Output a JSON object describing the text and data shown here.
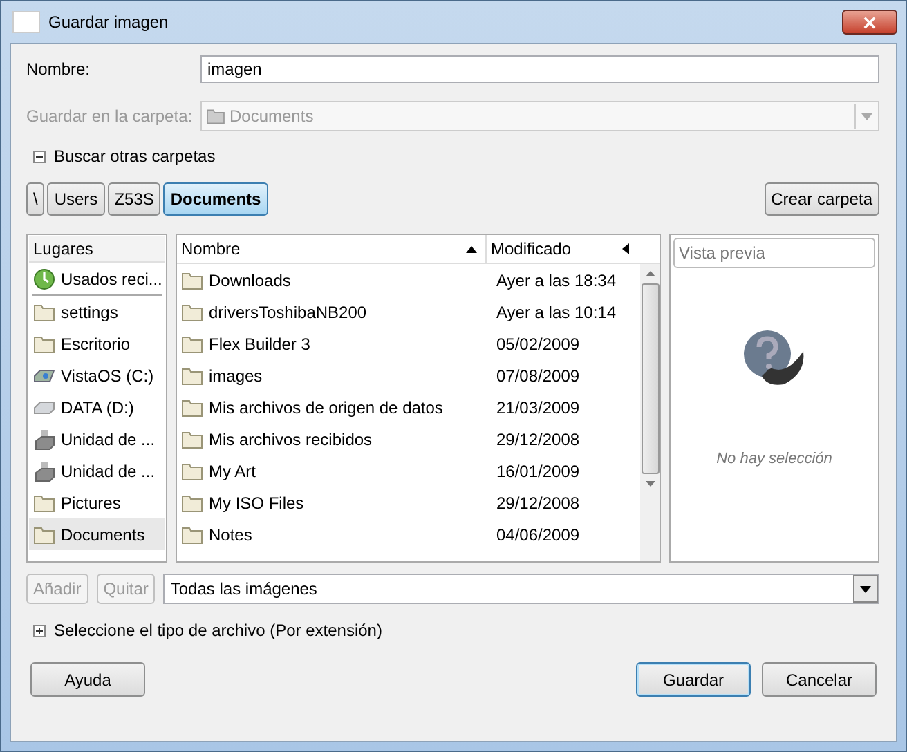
{
  "window": {
    "title": "Guardar imagen"
  },
  "name_field": {
    "label": "Nombre:",
    "value": "imagen"
  },
  "folder_field": {
    "label": "Guardar en la carpeta:",
    "value": "Documents",
    "disabled": true
  },
  "browse_expander": {
    "label": "Buscar otras carpetas",
    "expanded": true
  },
  "path_bar": [
    {
      "label": "\\",
      "selected": false
    },
    {
      "label": "Users",
      "selected": false
    },
    {
      "label": "Z53S",
      "selected": false
    },
    {
      "label": "Documents",
      "selected": true
    }
  ],
  "create_folder_button": "Crear carpeta",
  "places": {
    "heading": "Lugares",
    "items": [
      {
        "label": "Usados reci...",
        "kind": "recent",
        "selected": false
      },
      {
        "label": "settings",
        "kind": "folder",
        "selected": false
      },
      {
        "label": "Escritorio",
        "kind": "folder",
        "selected": false
      },
      {
        "label": "VistaOS (C:)",
        "kind": "system-drive",
        "selected": false
      },
      {
        "label": "DATA (D:)",
        "kind": "drive",
        "selected": false
      },
      {
        "label": "Unidad de ...",
        "kind": "removable",
        "selected": false
      },
      {
        "label": "Unidad de ...",
        "kind": "removable",
        "selected": false
      },
      {
        "label": "Pictures",
        "kind": "folder",
        "selected": false
      },
      {
        "label": "Documents",
        "kind": "folder",
        "selected": true
      }
    ]
  },
  "files": {
    "columns": [
      "Nombre",
      "Modificado"
    ],
    "rows": [
      {
        "name": "Downloads",
        "modified": "Ayer a las 18:34"
      },
      {
        "name": "driversToshibaNB200",
        "modified": "Ayer a las 10:14"
      },
      {
        "name": "Flex Builder 3",
        "modified": "05/02/2009"
      },
      {
        "name": "images",
        "modified": "07/08/2009"
      },
      {
        "name": "Mis archivos de origen de datos",
        "modified": "21/03/2009"
      },
      {
        "name": "Mis archivos recibidos",
        "modified": "29/12/2008"
      },
      {
        "name": "My Art",
        "modified": "16/01/2009"
      },
      {
        "name": "My ISO Files",
        "modified": "29/12/2008"
      },
      {
        "name": "Notes",
        "modified": "04/06/2009"
      }
    ]
  },
  "preview": {
    "label": "Vista previa",
    "message": "No hay selección"
  },
  "add_button": {
    "label": "Añadir",
    "disabled": true
  },
  "remove_button": {
    "label": "Quitar",
    "disabled": true
  },
  "filter": {
    "value": "Todas las imágenes"
  },
  "type_expander": {
    "label": "Seleccione el tipo de archivo (Por extensión)",
    "expanded": false
  },
  "buttons": [
    {
      "label": "Ayuda",
      "kind": "help"
    },
    {
      "label": "Guardar",
      "kind": "default"
    },
    {
      "label": "Cancelar",
      "kind": "normal"
    }
  ]
}
